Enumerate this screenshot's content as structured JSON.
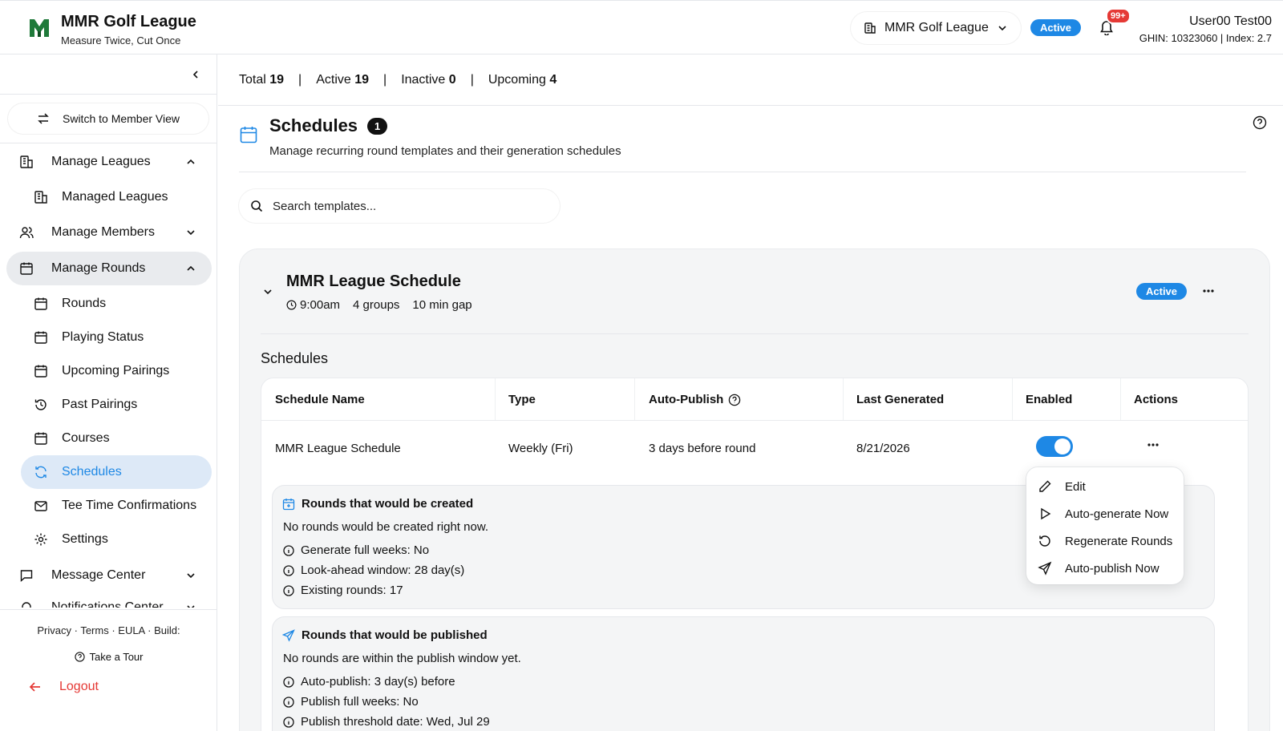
{
  "header": {
    "brand_title": "MMR Golf League",
    "brand_subtitle": "Measure Twice, Cut Once",
    "league_selector": "MMR Golf League",
    "status_badge": "Active",
    "notification_count": "99+",
    "user_name": "User00 Test00",
    "user_sub": "GHIN: 10323060 | Index: 2.7"
  },
  "sidebar": {
    "switch_view": "Switch to Member View",
    "manage_leagues": "Manage Leagues",
    "managed_leagues": "Managed Leagues",
    "manage_members": "Manage Members",
    "manage_rounds": "Manage Rounds",
    "rounds": "Rounds",
    "playing_status": "Playing Status",
    "upcoming_pairings": "Upcoming Pairings",
    "past_pairings": "Past Pairings",
    "courses": "Courses",
    "schedules": "Schedules",
    "tee_time_confirmations": "Tee Time Confirmations",
    "settings": "Settings",
    "message_center": "Message Center",
    "notifications_center": "Notifications Center",
    "footer_links": "Privacy  ·  Terms  ·  EULA  ·  Build:",
    "take_tour": "Take a Tour",
    "logout": "Logout"
  },
  "stats": {
    "total_label": "Total",
    "total_value": "19",
    "active_label": "Active",
    "active_value": "19",
    "inactive_label": "Inactive",
    "inactive_value": "0",
    "upcoming_label": "Upcoming",
    "upcoming_value": "4",
    "divider": "|"
  },
  "page": {
    "title": "Schedules",
    "count": "1",
    "subtitle": "Manage recurring round templates and their generation schedules",
    "search_placeholder": "Search templates..."
  },
  "template": {
    "name": "MMR League Schedule",
    "time": "9:00am",
    "groups": "4 groups",
    "gap": "10 min gap",
    "status": "Active",
    "schedules_heading": "Schedules"
  },
  "table": {
    "headers": [
      "Schedule Name",
      "Type",
      "Auto-Publish",
      "Last Generated",
      "Enabled",
      "Actions"
    ],
    "row": {
      "name": "MMR League Schedule",
      "type": "Weekly (Fri)",
      "auto_publish": "3 days before round",
      "last_generated": "8/21/2026",
      "enabled": true
    }
  },
  "created_box": {
    "title": "Rounds that would be created",
    "message": "No rounds would be created right now.",
    "items": [
      "Generate full weeks: No",
      "Look-ahead window: 28 day(s)",
      "Existing rounds: 17"
    ]
  },
  "published_box": {
    "title": "Rounds that would be published",
    "message": "No rounds are within the publish window yet.",
    "items": [
      "Auto-publish: 3 day(s) before",
      "Publish full weeks: No",
      "Publish threshold date: Wed, Jul 29"
    ]
  },
  "actions_menu": [
    "Edit",
    "Auto-generate Now",
    "Regenerate Rounds",
    "Auto-publish Now"
  ],
  "colors": {
    "accent": "#1e88e5",
    "danger": "#e53935",
    "brand_green": "#1f7a3a"
  }
}
